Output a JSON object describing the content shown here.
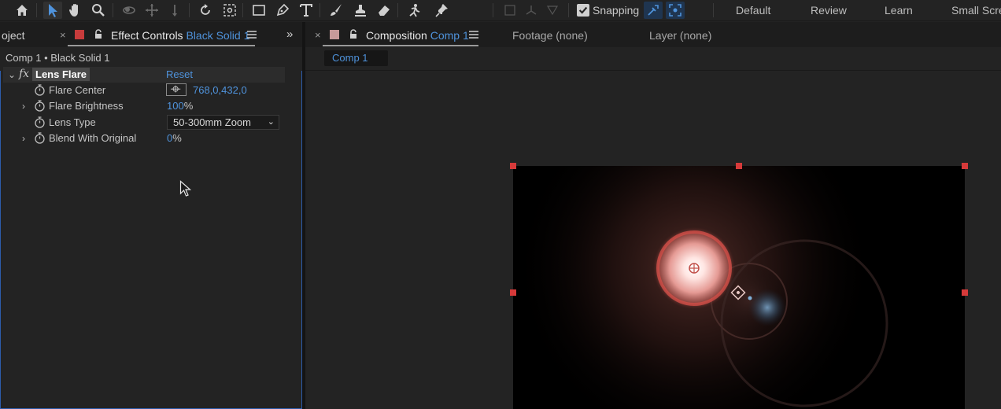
{
  "toolbar": {
    "snapping_label": "Snapping",
    "workspaces": [
      "Default",
      "Review",
      "Learn",
      "Small Scre"
    ]
  },
  "effect_controls_panel": {
    "project_tab_label": "oject",
    "tab_title": "Effect Controls",
    "tab_layer": "Black Solid 1",
    "breadcrumb": "Comp 1 • Black Solid 1",
    "effect": {
      "name": "Lens Flare",
      "reset_label": "Reset",
      "properties": [
        {
          "name": "Flare Center",
          "value": "768,0,432,0"
        },
        {
          "name": "Flare Brightness",
          "value": "100",
          "unit": "%"
        },
        {
          "name": "Lens Type",
          "value": "50-300mm Zoom"
        },
        {
          "name": "Blend With Original",
          "value": "0",
          "unit": "%"
        }
      ]
    }
  },
  "composition_panel": {
    "tab_title": "Composition",
    "tab_comp": "Comp 1",
    "footage_tab": "Footage (none)",
    "layer_tab": "Layer (none)",
    "active_subtab": "Comp 1"
  },
  "colors": {
    "accent_blue": "#4f93dc",
    "label_red": "#c83c3c",
    "handle_red": "#d63a3a",
    "focus_border": "#2d5cab"
  }
}
